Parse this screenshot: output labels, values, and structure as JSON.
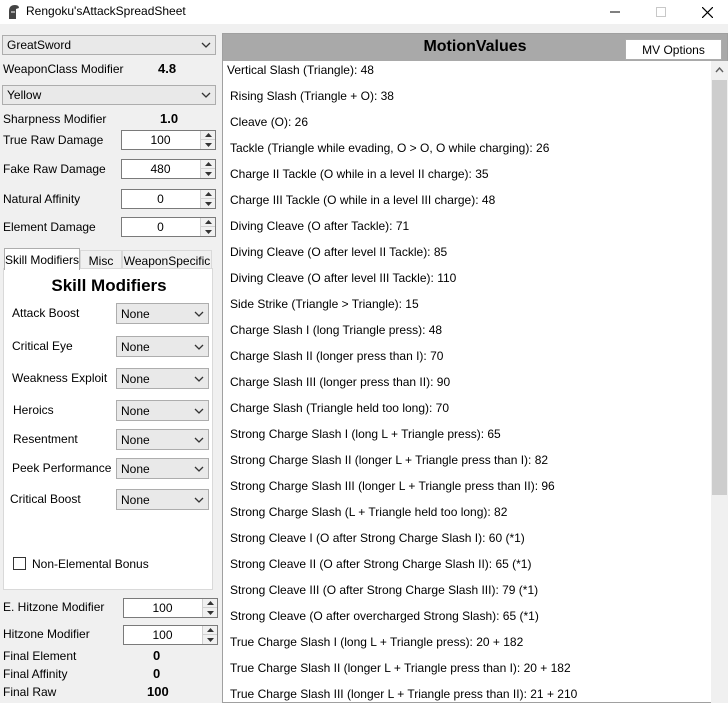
{
  "window": {
    "title": "Rengoku'sAttackSpreadSheet"
  },
  "weapon_select": {
    "value": "GreatSword"
  },
  "weapon_class": {
    "label": "WeaponClass Modifier",
    "value": "4.8"
  },
  "sharpness_select": {
    "value": "Yellow"
  },
  "sharpness": {
    "label": "Sharpness Modifier",
    "value": "1.0"
  },
  "true_raw": {
    "label": "True Raw Damage",
    "value": "100"
  },
  "fake_raw": {
    "label": "Fake Raw Damage",
    "value": "480"
  },
  "affinity": {
    "label": "Natural Affinity",
    "value": "0"
  },
  "element": {
    "label": "Element Damage",
    "value": "0"
  },
  "tabs": [
    {
      "label": "Skill Modifiers"
    },
    {
      "label": "Misc"
    },
    {
      "label": "WeaponSpecific"
    }
  ],
  "skills_panel": {
    "title": "Skill Modifiers",
    "skills": [
      {
        "label": "Attack Boost",
        "value": "None"
      },
      {
        "label": "Critical Eye",
        "value": "None"
      },
      {
        "label": "Weakness Exploit",
        "value": "None"
      },
      {
        "label": "Heroics",
        "value": "None"
      },
      {
        "label": "Resentment",
        "value": "None"
      },
      {
        "label": "Peek Performance",
        "value": "None"
      },
      {
        "label": "Critical Boost",
        "value": "None"
      }
    ],
    "non_elemental": "Non-Elemental Bonus"
  },
  "e_hitzone": {
    "label": "E. Hitzone Modifier",
    "value": "100"
  },
  "hitzone": {
    "label": "Hitzone Modifier",
    "value": "100"
  },
  "final_element": {
    "label": "Final Element",
    "value": "0"
  },
  "final_affinity": {
    "label": "Final Affinity",
    "value": "0"
  },
  "final_raw": {
    "label": "Final Raw",
    "value": "100"
  },
  "motion_values": {
    "title": "MotionValues",
    "options_label": "MV Options",
    "items": [
      "Vertical Slash (Triangle): 48",
      "Rising Slash (Triangle + O): 38",
      "Cleave (O): 26",
      "Tackle (Triangle while evading, O > O, O while charging): 26",
      "Charge II Tackle (O while in a level II charge): 35",
      "Charge III Tackle (O while in a level III charge): 48",
      "Diving Cleave (O after Tackle): 71",
      "Diving Cleave (O after level II Tackle): 85",
      "Diving Cleave (O after level III Tackle): 110",
      "Side Strike (Triangle > Triangle): 15",
      "Charge Slash I (long Triangle press): 48",
      "Charge Slash II (longer press than I): 70",
      "Charge Slash III (longer press than II): 90",
      "Charge Slash (Triangle held too long): 70",
      "Strong Charge Slash I (long L + Triangle press): 65",
      "Strong Charge Slash II (longer L + Triangle press than I): 82",
      "Strong Charge Slash III (longer L + Triangle press than II): 96",
      "Strong Charge Slash (L + Triangle held too long): 82",
      "Strong Cleave I (O after Strong Charge Slash I): 60  (*1)",
      "Strong Cleave II (O after Strong Charge Slash II): 65  (*1)",
      "Strong Cleave III (O after Strong Charge Slash III): 79  (*1)",
      "Strong Cleave (O after overcharged Strong Slash): 65  (*1)",
      "True Charge Slash I (long L + Triangle press): 20  + 182",
      "True Charge Slash II (longer L + Triangle press than I): 20  + 182",
      "True Charge Slash III (longer L + Triangle press than II): 21  + 210"
    ]
  }
}
